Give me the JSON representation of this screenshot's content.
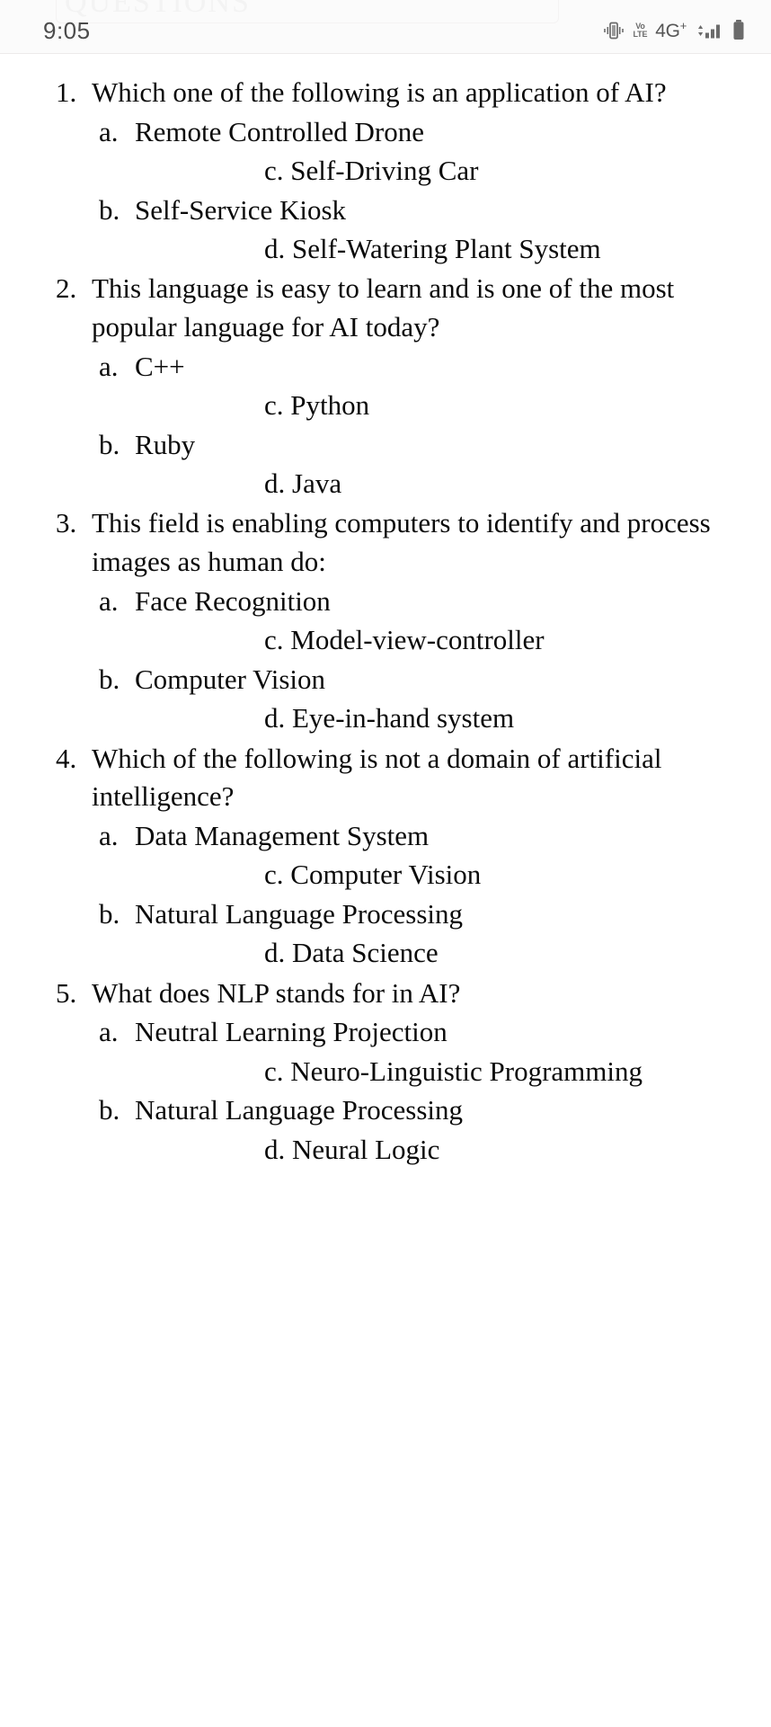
{
  "document": {
    "ghost_heading": "QUESTIONS"
  },
  "status_bar": {
    "time": "9:05",
    "icons": [
      {
        "name": "vibrate-icon",
        "label": "vibrate"
      },
      {
        "name": "volte-icon",
        "label_top": "Vo",
        "label_bottom": "LTE"
      },
      {
        "name": "network-type-label",
        "label": "4G",
        "superscript": "+"
      },
      {
        "name": "signal-bars-icon",
        "label": "signal"
      },
      {
        "name": "battery-icon",
        "label": "battery"
      }
    ]
  },
  "questions": [
    {
      "number": "1.",
      "text": "Which one of the following is an application of AI?",
      "options": [
        {
          "letter": "a.",
          "text": "Remote Controlled Drone",
          "style": "left"
        },
        {
          "letter": "c.",
          "text": "Self-Driving Car",
          "style": "tabbed"
        },
        {
          "letter": "b.",
          "text": "Self-Service Kiosk",
          "style": "left"
        },
        {
          "letter": "d.",
          "text": "Self-Watering Plant System",
          "style": "tabbed"
        }
      ]
    },
    {
      "number": "2.",
      "text": "This language is easy to learn and is one of the most popular language for AI today?",
      "options": [
        {
          "letter": "a.",
          "text": "C++",
          "style": "left"
        },
        {
          "letter": "c.",
          "text": "Python",
          "style": "tabbed"
        },
        {
          "letter": "b.",
          "text": "Ruby",
          "style": "left"
        },
        {
          "letter": "d.",
          "text": "Java",
          "style": "tabbed"
        }
      ]
    },
    {
      "number": "3.",
      "text": "This field is enabling computers to identify and process images as human do:",
      "options": [
        {
          "letter": "a.",
          "text": "Face Recognition",
          "style": "left"
        },
        {
          "letter": "c.",
          "text": "Model-view-controller",
          "style": "tabbed"
        },
        {
          "letter": "b.",
          "text": "Computer Vision",
          "style": "left"
        },
        {
          "letter": "d.",
          "text": "Eye-in-hand system",
          "style": "tabbed"
        }
      ]
    },
    {
      "number": "4.",
      "text": "Which of the following is not a domain of artificial intelligence?",
      "options": [
        {
          "letter": "a.",
          "text": "Data Management System",
          "style": "left"
        },
        {
          "letter": "c.",
          "text": "Computer Vision",
          "style": "tabbed"
        },
        {
          "letter": "b.",
          "text": "Natural Language Processing",
          "style": "left"
        },
        {
          "letter": "d.",
          "text": "Data Science",
          "style": "tabbed"
        }
      ]
    },
    {
      "number": "5.",
      "text": "What does NLP stands for in AI?",
      "options": [
        {
          "letter": "a.",
          "text": "Neutral Learning Projection",
          "style": "left"
        },
        {
          "letter": "c.",
          "text": "Neuro-Linguistic Programming",
          "style": "tabbed"
        },
        {
          "letter": "b.",
          "text": "Natural Language Processing",
          "style": "left"
        },
        {
          "letter": "d.",
          "text": "Neural Logic",
          "style": "tabbed"
        }
      ]
    }
  ],
  "colors": {
    "page_background": "#ffffff",
    "text": "#0b0b0b",
    "status_bar_background": "#fbfbfb",
    "status_icon": "#6b6b6b",
    "ghost_heading": "#f3f3f3"
  }
}
